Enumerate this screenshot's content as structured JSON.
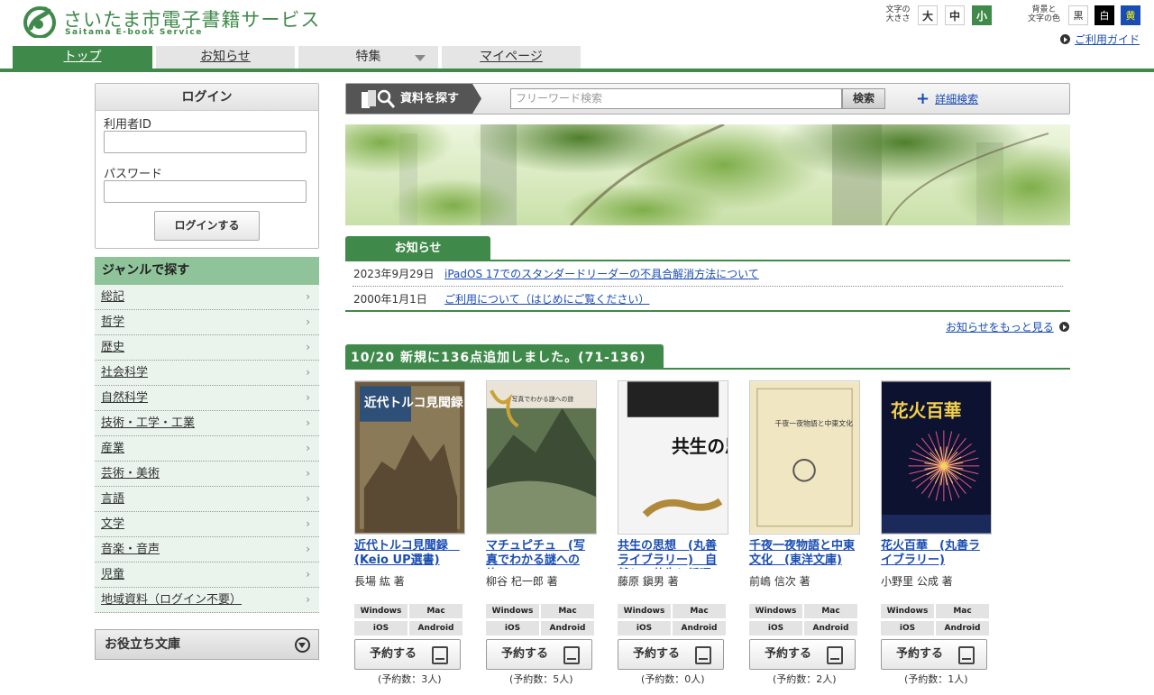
{
  "header": {
    "title": "さいたま市電子書籍サービス",
    "subtitle": "Saitama E-book Service",
    "font_size_label": "文字の\n大きさ",
    "font_sizes": [
      "大",
      "中",
      "小"
    ],
    "color_label": "背景と\n文字の色",
    "colors": [
      "黒",
      "白",
      "黄"
    ],
    "guide_link": "ご利用ガイド"
  },
  "nav": {
    "tabs": [
      {
        "label": "トップ"
      },
      {
        "label": "お知らせ"
      },
      {
        "label": "特集"
      },
      {
        "label": "マイページ"
      }
    ]
  },
  "login": {
    "heading": "ログイン",
    "user_id_label": "利用者ID",
    "password_label": "パスワード",
    "submit_label": "ログインする"
  },
  "genre": {
    "heading": "ジャンルで探す",
    "items": [
      "総記",
      "哲学",
      "歴史",
      "社会科学",
      "自然科学",
      "技術・工学・工業",
      "産業",
      "芸術・美術",
      "言語",
      "文学",
      "音楽・音声",
      "児童",
      "地域資料（ログイン不要）"
    ]
  },
  "useful": {
    "label": "お役立ち文庫"
  },
  "search": {
    "label": "資料を探す",
    "placeholder": "フリーワード検索",
    "button": "検索",
    "advanced": "詳細検索"
  },
  "news": {
    "heading": "お知らせ",
    "items": [
      {
        "date": "2023年9月29日",
        "title": "iPadOS 17でのスタンダードリーダーの不具合解消方法について"
      },
      {
        "date": "2000年1月1日",
        "title": "ご利用について（はじめにご覧ください）"
      }
    ],
    "more": "お知らせをもっと見る"
  },
  "new_arrivals": {
    "heading": "10/20 新規に136点追加しました。(71-136)",
    "platforms": [
      "Windows",
      "Mac",
      "iOS",
      "Android"
    ],
    "reserve_label": "予約する",
    "books": [
      {
        "title": "近代トルコ見聞録　(Keio UP選書)",
        "author": "長場 紘 著",
        "reservations": "(予約数：3人)",
        "cover_text": "近代トルコ見聞録"
      },
      {
        "title": "マチュピチュ　(写真でわかる謎への旅)",
        "author": "柳谷 杞一郎 著",
        "reservations": "(予約数：5人)",
        "cover_text": "写真でわかる謎への旅"
      },
      {
        "title": "共生の思想　(丸善ライブラリー)　自然との共生と循環",
        "author": "藤原 鎭男 著",
        "reservations": "(予約数：0人)",
        "cover_text": "共生の思想"
      },
      {
        "title": "千夜一夜物語と中東文化　(東洋文庫)",
        "author": "前嶋 信次 著",
        "reservations": "(予約数：2人)",
        "cover_text": "千夜一夜物語と中東文化"
      },
      {
        "title": "花火百華　(丸善ライブラリー)",
        "author": "小野里 公成 著",
        "reservations": "(予約数：1人)",
        "cover_text": "花火百華"
      }
    ]
  },
  "colors": {
    "brand_green": "#3f8a4a",
    "genre_green": "#8fc49a",
    "link_blue": "#1a4db3"
  }
}
